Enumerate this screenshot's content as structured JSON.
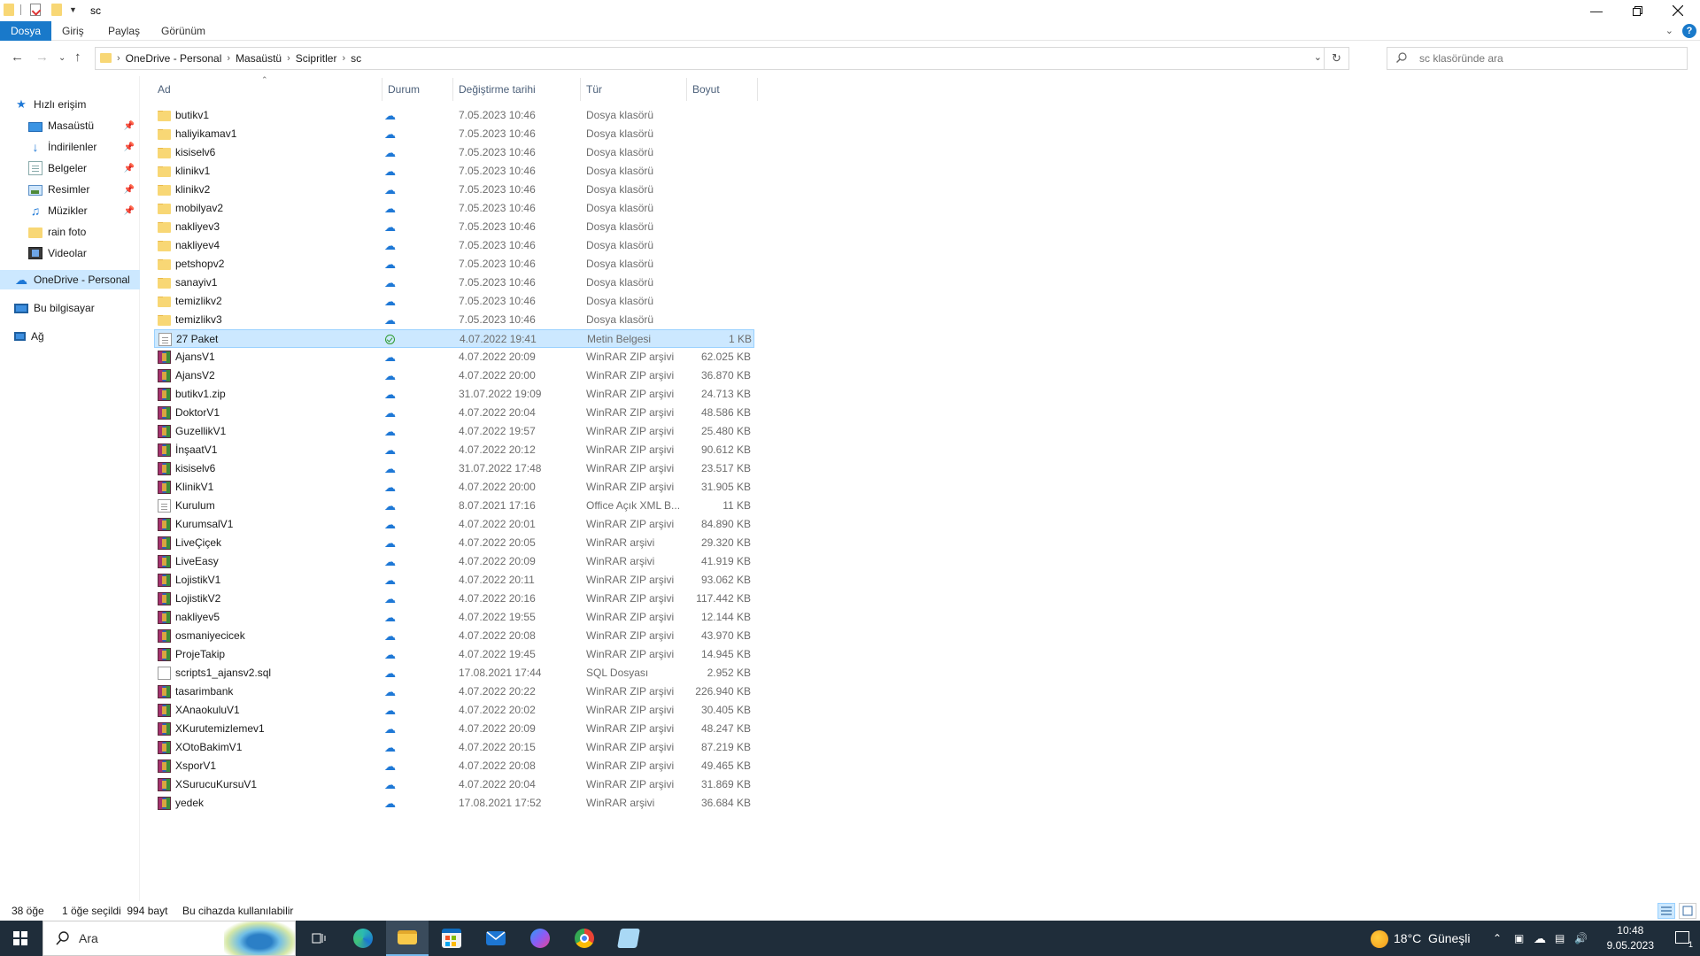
{
  "window": {
    "title": "sc",
    "ribbon_tabs": [
      "Dosya",
      "Giriş",
      "Paylaş",
      "Görünüm"
    ]
  },
  "address": {
    "breadcrumbs": [
      "OneDrive - Personal",
      "Masaüstü",
      "Scipritler",
      "sc"
    ]
  },
  "search": {
    "placeholder": "sc klasöründe ara"
  },
  "sidebar": {
    "items": [
      {
        "label": "Hızlı erişim",
        "icon": "star-icon",
        "pinned": false
      },
      {
        "label": "Masaüstü",
        "icon": "desktop-icon",
        "pinned": true
      },
      {
        "label": "İndirilenler",
        "icon": "download-icon",
        "pinned": true
      },
      {
        "label": "Belgeler",
        "icon": "documents-icon",
        "pinned": true
      },
      {
        "label": "Resimler",
        "icon": "pictures-icon",
        "pinned": true
      },
      {
        "label": "Müzikler",
        "icon": "music-icon",
        "pinned": true
      },
      {
        "label": "rain foto",
        "icon": "folder-icon",
        "pinned": false
      },
      {
        "label": "Videolar",
        "icon": "videos-icon",
        "pinned": false
      },
      {
        "label": "OneDrive - Personal",
        "icon": "cloud-icon",
        "pinned": false
      },
      {
        "label": "Bu bilgisayar",
        "icon": "computer-icon",
        "pinned": false
      },
      {
        "label": "Ağ",
        "icon": "network-icon",
        "pinned": false
      }
    ]
  },
  "columns": {
    "name": "Ad",
    "status": "Durum",
    "modified": "Değiştirme tarihi",
    "type": "Tür",
    "size": "Boyut"
  },
  "files": [
    {
      "name": "butikv1",
      "date": "7.05.2023 10:46",
      "type": "Dosya klasörü",
      "size": "",
      "icon": "folder",
      "status": "cloud"
    },
    {
      "name": "haliyikamav1",
      "date": "7.05.2023 10:46",
      "type": "Dosya klasörü",
      "size": "",
      "icon": "folder",
      "status": "cloud"
    },
    {
      "name": "kisiselv6",
      "date": "7.05.2023 10:46",
      "type": "Dosya klasörü",
      "size": "",
      "icon": "folder",
      "status": "cloud"
    },
    {
      "name": "klinikv1",
      "date": "7.05.2023 10:46",
      "type": "Dosya klasörü",
      "size": "",
      "icon": "folder",
      "status": "cloud"
    },
    {
      "name": "klinikv2",
      "date": "7.05.2023 10:46",
      "type": "Dosya klasörü",
      "size": "",
      "icon": "folder",
      "status": "cloud"
    },
    {
      "name": "mobilyav2",
      "date": "7.05.2023 10:46",
      "type": "Dosya klasörü",
      "size": "",
      "icon": "folder",
      "status": "cloud"
    },
    {
      "name": "nakliyev3",
      "date": "7.05.2023 10:46",
      "type": "Dosya klasörü",
      "size": "",
      "icon": "folder",
      "status": "cloud"
    },
    {
      "name": "nakliyev4",
      "date": "7.05.2023 10:46",
      "type": "Dosya klasörü",
      "size": "",
      "icon": "folder",
      "status": "cloud"
    },
    {
      "name": "petshopv2",
      "date": "7.05.2023 10:46",
      "type": "Dosya klasörü",
      "size": "",
      "icon": "folder",
      "status": "cloud"
    },
    {
      "name": "sanayiv1",
      "date": "7.05.2023 10:46",
      "type": "Dosya klasörü",
      "size": "",
      "icon": "folder",
      "status": "cloud"
    },
    {
      "name": "temizlikv2",
      "date": "7.05.2023 10:46",
      "type": "Dosya klasörü",
      "size": "",
      "icon": "folder",
      "status": "cloud"
    },
    {
      "name": "temizlikv3",
      "date": "7.05.2023 10:46",
      "type": "Dosya klasörü",
      "size": "",
      "icon": "folder",
      "status": "cloud"
    },
    {
      "name": "27 Paket",
      "date": "4.07.2022 19:41",
      "type": "Metin Belgesi",
      "size": "1 KB",
      "icon": "text",
      "status": "synced"
    },
    {
      "name": "AjansV1",
      "date": "4.07.2022 20:09",
      "type": "WinRAR ZIP arşivi",
      "size": "62.025 KB",
      "icon": "rar",
      "status": "cloud"
    },
    {
      "name": "AjansV2",
      "date": "4.07.2022 20:00",
      "type": "WinRAR ZIP arşivi",
      "size": "36.870 KB",
      "icon": "rar",
      "status": "cloud"
    },
    {
      "name": "butikv1.zip",
      "date": "31.07.2022 19:09",
      "type": "WinRAR ZIP arşivi",
      "size": "24.713 KB",
      "icon": "rar",
      "status": "cloud"
    },
    {
      "name": "DoktorV1",
      "date": "4.07.2022 20:04",
      "type": "WinRAR ZIP arşivi",
      "size": "48.586 KB",
      "icon": "rar",
      "status": "cloud"
    },
    {
      "name": "GuzellikV1",
      "date": "4.07.2022 19:57",
      "type": "WinRAR ZIP arşivi",
      "size": "25.480 KB",
      "icon": "rar",
      "status": "cloud"
    },
    {
      "name": "İnşaatV1",
      "date": "4.07.2022 20:12",
      "type": "WinRAR ZIP arşivi",
      "size": "90.612 KB",
      "icon": "rar",
      "status": "cloud"
    },
    {
      "name": "kisiselv6",
      "date": "31.07.2022 17:48",
      "type": "WinRAR ZIP arşivi",
      "size": "23.517 KB",
      "icon": "rar",
      "status": "cloud"
    },
    {
      "name": "KlinikV1",
      "date": "4.07.2022 20:00",
      "type": "WinRAR ZIP arşivi",
      "size": "31.905 KB",
      "icon": "rar",
      "status": "cloud"
    },
    {
      "name": "Kurulum",
      "date": "8.07.2021 17:16",
      "type": "Office Açık XML B...",
      "size": "11 KB",
      "icon": "xml",
      "status": "cloud"
    },
    {
      "name": "KurumsalV1",
      "date": "4.07.2022 20:01",
      "type": "WinRAR ZIP arşivi",
      "size": "84.890 KB",
      "icon": "rar",
      "status": "cloud"
    },
    {
      "name": "LiveÇiçek",
      "date": "4.07.2022 20:05",
      "type": "WinRAR arşivi",
      "size": "29.320 KB",
      "icon": "rar",
      "status": "cloud"
    },
    {
      "name": "LiveEasy",
      "date": "4.07.2022 20:09",
      "type": "WinRAR arşivi",
      "size": "41.919 KB",
      "icon": "rar",
      "status": "cloud"
    },
    {
      "name": "LojistikV1",
      "date": "4.07.2022 20:11",
      "type": "WinRAR ZIP arşivi",
      "size": "93.062 KB",
      "icon": "rar",
      "status": "cloud"
    },
    {
      "name": "LojistikV2",
      "date": "4.07.2022 20:16",
      "type": "WinRAR ZIP arşivi",
      "size": "117.442 KB",
      "icon": "rar",
      "status": "cloud"
    },
    {
      "name": "nakliyev5",
      "date": "4.07.2022 19:55",
      "type": "WinRAR ZIP arşivi",
      "size": "12.144 KB",
      "icon": "rar",
      "status": "cloud"
    },
    {
      "name": "osmaniyecicek",
      "date": "4.07.2022 20:08",
      "type": "WinRAR ZIP arşivi",
      "size": "43.970 KB",
      "icon": "rar",
      "status": "cloud"
    },
    {
      "name": "ProjeTakip",
      "date": "4.07.2022 19:45",
      "type": "WinRAR ZIP arşivi",
      "size": "14.945 KB",
      "icon": "rar",
      "status": "cloud"
    },
    {
      "name": "scripts1_ajansv2.sql",
      "date": "17.08.2021 17:44",
      "type": "SQL Dosyası",
      "size": "2.952 KB",
      "icon": "sql",
      "status": "cloud"
    },
    {
      "name": "tasarimbank",
      "date": "4.07.2022 20:22",
      "type": "WinRAR ZIP arşivi",
      "size": "226.940 KB",
      "icon": "rar",
      "status": "cloud"
    },
    {
      "name": "XAnaokuluV1",
      "date": "4.07.2022 20:02",
      "type": "WinRAR ZIP arşivi",
      "size": "30.405 KB",
      "icon": "rar",
      "status": "cloud"
    },
    {
      "name": "XKurutemizlemev1",
      "date": "4.07.2022 20:09",
      "type": "WinRAR ZIP arşivi",
      "size": "48.247 KB",
      "icon": "rar",
      "status": "cloud"
    },
    {
      "name": "XOtoBakimV1",
      "date": "4.07.2022 20:15",
      "type": "WinRAR ZIP arşivi",
      "size": "87.219 KB",
      "icon": "rar",
      "status": "cloud"
    },
    {
      "name": "XsporV1",
      "date": "4.07.2022 20:08",
      "type": "WinRAR ZIP arşivi",
      "size": "49.465 KB",
      "icon": "rar",
      "status": "cloud"
    },
    {
      "name": "XSurucuKursuV1",
      "date": "4.07.2022 20:04",
      "type": "WinRAR ZIP arşivi",
      "size": "31.869 KB",
      "icon": "rar",
      "status": "cloud"
    },
    {
      "name": "yedek",
      "date": "17.08.2021 17:52",
      "type": "WinRAR arşivi",
      "size": "36.684 KB",
      "icon": "rar",
      "status": "cloud"
    }
  ],
  "selected_index": 12,
  "statusbar": {
    "count": "38 öğe",
    "selection": "1 öğe seçildi  994 bayt",
    "availability": "Bu cihazda kullanılabilir"
  },
  "taskbar": {
    "search_label": "Ara",
    "weather": "18°C  Güneşli",
    "time": "10:48",
    "date": "9.05.2023",
    "notification_count": "1",
    "apps": [
      "task-view-icon",
      "edge-icon",
      "file-explorer-icon",
      "store-icon",
      "mail-icon",
      "copilot-icon",
      "chrome-icon",
      "notepad-icon"
    ]
  },
  "colors": {
    "accent": "#1979ca",
    "selection": "#cce8ff",
    "folder": "#f8d775",
    "taskbar": "#1f2d3a"
  }
}
